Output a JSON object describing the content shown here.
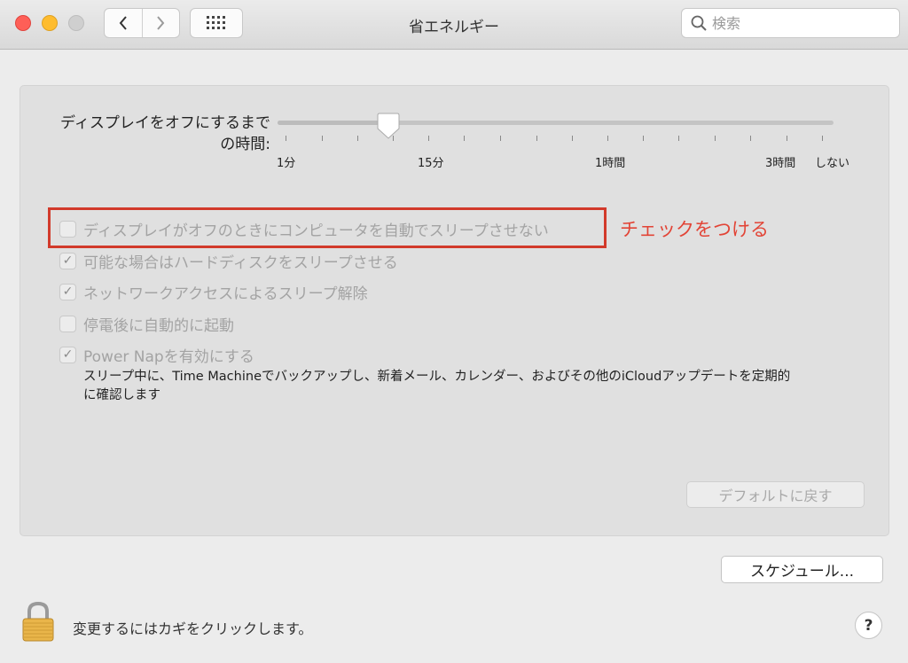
{
  "window": {
    "title": "省エネルギー"
  },
  "toolbar": {
    "back_icon": "chevron-left",
    "forward_icon": "chevron-right",
    "grid_icon": "grid",
    "search_placeholder": "検索"
  },
  "display_sleep": {
    "label_line1": "ディスプレイをオフにするまで",
    "label_line2": "の時間:",
    "level": 0.2,
    "ticks": [
      "1分",
      "15分",
      "1時間",
      "3時間",
      "しない"
    ]
  },
  "options": [
    {
      "label": "ディスプレイがオフのときにコンピュータを自動でスリープさせない",
      "checked": false
    },
    {
      "label": "可能な場合はハードディスクをスリープさせる",
      "checked": true
    },
    {
      "label": "ネットワークアクセスによるスリープ解除",
      "checked": true
    },
    {
      "label": "停電後に自動的に起動",
      "checked": false
    },
    {
      "label": "Power Napを有効にする",
      "checked": true
    }
  ],
  "power_nap_description": "スリープ中に、Time Machineでバックアップし、新着メール、カレンダー、およびその他のiCloudアップデートを定期的に確認します",
  "annotation": {
    "text": "チェックをつける",
    "color": "#e24436"
  },
  "buttons": {
    "restore_defaults": "デフォルトに戻す",
    "schedule": "スケジュール...",
    "help": "?"
  },
  "lock": {
    "text": "変更するにはカギをクリックします。"
  }
}
